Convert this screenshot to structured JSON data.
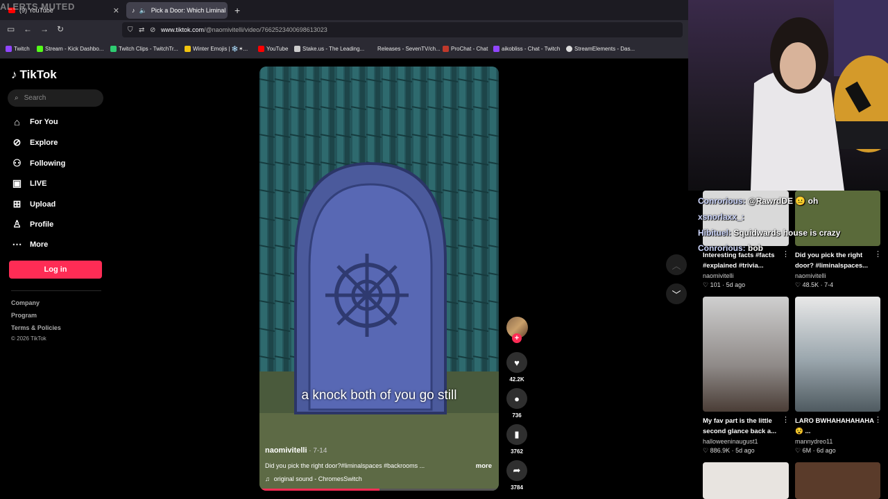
{
  "overlay": {
    "alerts_muted": "ALERTS MUTED"
  },
  "browser": {
    "tabs": [
      {
        "label": "(9) YouTube",
        "icon": "youtube-icon"
      },
      {
        "label": "Pick a Door: Which Liminal",
        "icon": "tiktok-icon"
      }
    ],
    "url_host": "www.tiktok.com",
    "url_path": "/@naomivitelli/video/7662523400698613023",
    "bookmarks": [
      {
        "label": "Twitch",
        "color": "#9146ff"
      },
      {
        "label": "Stream - Kick Dashbo...",
        "color": "#53fc18"
      },
      {
        "label": "Twitch Clips - TwitchTr...",
        "color": "#2ecc71"
      },
      {
        "label": "Winter Emojis | ❄️✶...",
        "color": "#f1c40f"
      },
      {
        "label": "YouTube",
        "color": "#ff0000"
      },
      {
        "label": "Stake.us - The Leading...",
        "color": "#cccccc"
      },
      {
        "label": "Releases - SevenTV/ch...",
        "color": "#2b2a33"
      },
      {
        "label": "ProChat - Chat",
        "color": "#c0392b"
      },
      {
        "label": "aikobliss - Chat - Twitch",
        "color": "#9146ff"
      },
      {
        "label": "StreamElements - Das...",
        "color": "#dddddd"
      }
    ]
  },
  "tiktok": {
    "logo": "TikTok",
    "search_placeholder": "Search",
    "nav": [
      {
        "label": "For You",
        "icon": "home-icon"
      },
      {
        "label": "Explore",
        "icon": "compass-icon"
      },
      {
        "label": "Following",
        "icon": "following-icon"
      },
      {
        "label": "LIVE",
        "icon": "live-icon"
      },
      {
        "label": "Upload",
        "icon": "upload-icon"
      },
      {
        "label": "Profile",
        "icon": "profile-icon"
      },
      {
        "label": "More",
        "icon": "more-icon"
      }
    ],
    "login_label": "Log in",
    "footer": {
      "company": "Company",
      "program": "Program",
      "terms": "Terms & Policies",
      "copyright": "© 2026 TikTok"
    }
  },
  "video": {
    "subtitle": "a knock both of you go still",
    "username": "naomivitelli",
    "date": " · 7-14",
    "description": "Did you pick the right door?#liminalspaces #backrooms ...",
    "more_label": "more",
    "sound": "original sound - ChromesSwitch",
    "progress_fraction": 0.5,
    "likes": "42.2K",
    "comments": "736",
    "saves": "3762",
    "shares": "3784"
  },
  "chat": [
    {
      "name": "Conrorious:",
      "message": "@RawrdDE 😐 oh"
    },
    {
      "name": "xsnorlaxx_:",
      "message": ""
    },
    {
      "name": "Hibituel:",
      "message": "Squidwards house is crazy"
    },
    {
      "name": "Conrorious:",
      "message": "bob"
    }
  ],
  "related": [
    {
      "title": "Interesting facts #facts #explained #trivia...",
      "author": "naomivitelli",
      "stats": "♡ 101 · 5d ago"
    },
    {
      "title": "Did you pick the right door? #liminalspaces...",
      "author": "naomivitelli",
      "stats": "♡ 48.5K · 7-4"
    },
    {
      "title": "My fav part is the little second glance back a...",
      "author": "halloweeninaugust1",
      "stats": "♡ 886.9K · 5d ago"
    },
    {
      "title": "LARO BWHAHAHAHAHA 😵 ...",
      "author": "mannydreo11",
      "stats": "♡ 6M · 6d ago"
    }
  ]
}
